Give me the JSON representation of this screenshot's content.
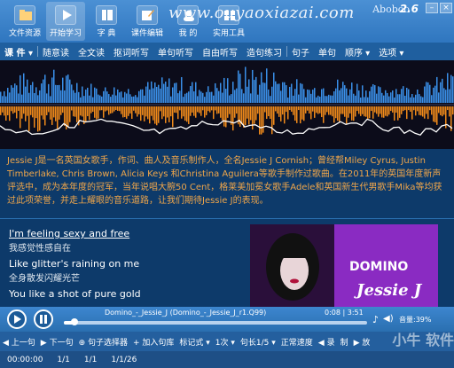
{
  "app": {
    "brand": "Aboboo",
    "version": "2.6"
  },
  "watermark": "www.ouyaoxiazai.com",
  "watermark_corner": "小牛 软件",
  "toolbar": [
    {
      "label": "文件资源",
      "icon": "folder-icon"
    },
    {
      "label": "开始学习",
      "icon": "play-icon"
    },
    {
      "label": "字 典",
      "icon": "book-icon"
    },
    {
      "label": "课件编辑",
      "icon": "edit-icon"
    },
    {
      "label": "我 的",
      "icon": "user-icon"
    },
    {
      "label": "实用工具",
      "icon": "tools-icon"
    }
  ],
  "menu": [
    "课 件 ▾",
    "随意读",
    "全文读",
    "抠词听写",
    "单句听写",
    "自由听写",
    "造句练习",
    "句子",
    "单句",
    "顺序 ▾",
    "选项 ▾"
  ],
  "article": "Jessie J是一名英国女歌手，作词、曲人及音乐制作人，全名Jessie J Cornish；曾经帮Miley Cyrus, Justin Timberlake, Chris Brown, Alicia Keys 和Christina Aguilera等歌手制作过歌曲。在2011年的英国年度新声评选中，成为本年度的冠军，当年说唱大腕50 Cent，格莱美加冕女歌手Adele和英国新生代男歌手Mika等均获过此项荣誉，并走上耀眼的音乐道路，让我们期待Jessie J的表现。",
  "lyrics": [
    {
      "en": "I'm feeling sexy and free",
      "zh": "我感觉性感自在"
    },
    {
      "en": "Like glitter's raining on me",
      "zh": "全身散发闪耀光芒"
    },
    {
      "en": "You like a shot of pure gold",
      "zh": ""
    }
  ],
  "album": {
    "line1": "DOMINO",
    "line2": "Jessie J"
  },
  "player": {
    "track": "Domino_-_Jessie_J (Domino_-_Jessie_J_r1.Q99)",
    "time": "0:08 | 3:51",
    "progress": 0.035,
    "volume_label": "音量:39%"
  },
  "controls": [
    "◀ 上一句",
    "▶ 下一句",
    "⊕ 句子选择器",
    "+ 加入句库",
    "标记式 ▾",
    "1次 ▾",
    "句长1/5 ▾",
    "正常速度",
    "◀ 录",
    "制",
    "▶ 放"
  ],
  "status": [
    "00:00:00",
    "1/1",
    "1/1",
    "1/1/26"
  ],
  "colors": {
    "accent": "#2a6fb0",
    "article_text": "#f0a64a",
    "wave_blue": "#3a8fe8",
    "wave_orange": "#f08a1a"
  }
}
